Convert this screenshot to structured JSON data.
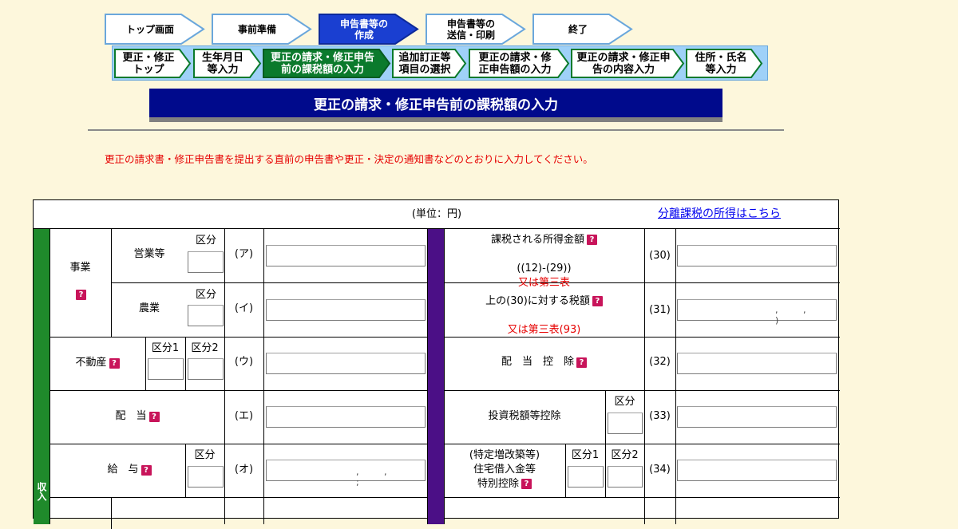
{
  "steps": [
    {
      "label": "トップ画面"
    },
    {
      "label": "事前準備"
    },
    {
      "label": "申告書等の\n作成"
    },
    {
      "label": "申告書等の\n送信・印刷"
    },
    {
      "label": "終了"
    }
  ],
  "substeps": [
    {
      "label": "更正・修正\nトップ"
    },
    {
      "label": "生年月日\n等入力"
    },
    {
      "label": "更正の請求・修正申告\n前の課税額の入力"
    },
    {
      "label": "追加訂正等\n項目の選択"
    },
    {
      "label": "更正の請求・修\n正申告額の入力"
    },
    {
      "label": "更正の請求・修正申\n告の内容入力"
    },
    {
      "label": "住所・氏名\n等入力"
    }
  ],
  "page_title": "更正の請求・修正申告前の課税額の入力",
  "notice": "更正の請求書・修正申告書を提出する直前の申告書や更正・決定の通知書などのとおりに入力してください。",
  "form": {
    "unit": "(単位：円)",
    "separate_tax_link": "分離課税の所得はこちら",
    "side_label": "収入",
    "help_icon": "?",
    "left": {
      "business": "事業",
      "eigyo": "営業等",
      "nogyo": "農業",
      "fudosan": "不動産",
      "haito": "配　当",
      "kyuyo": "給　与",
      "kubun": "区分",
      "kubun1": "区分1",
      "kubun2": "区分2",
      "code_a": "(ア)",
      "code_i": "(イ)",
      "code_u": "(ウ)",
      "code_e": "(エ)",
      "code_o": "(オ)",
      "kyuyo_sep": ", , ;"
    },
    "right": {
      "r30_label": "課税される所得金額",
      "r30_sub": "((12)-(29))",
      "r30_red": "又は第三表",
      "r31_label": "上の(30)に対する税額",
      "r31_red": "又は第三表(93)",
      "r32_label": "配　当　控　除",
      "r33_label": "投資税額等控除",
      "r34_label": "(特定増改築等)\n住宅借入金等\n特別控除",
      "kubun": "区分",
      "kubun1": "区分1",
      "kubun2": "区分2",
      "code_30": "(30)",
      "code_31": "(31)",
      "code_32": "(32)",
      "code_33": "(33)",
      "code_34": "(34)",
      "r31_sep": ", , )"
    }
  },
  "colors": {
    "background": "#fdf7dc",
    "title_bar": "#000a8c",
    "step_active": "#1a3fd1",
    "substep_active": "#0b7a2c",
    "left_band": "#1f8a2b",
    "right_band": "#4b0f86",
    "notice": "#e60000"
  }
}
